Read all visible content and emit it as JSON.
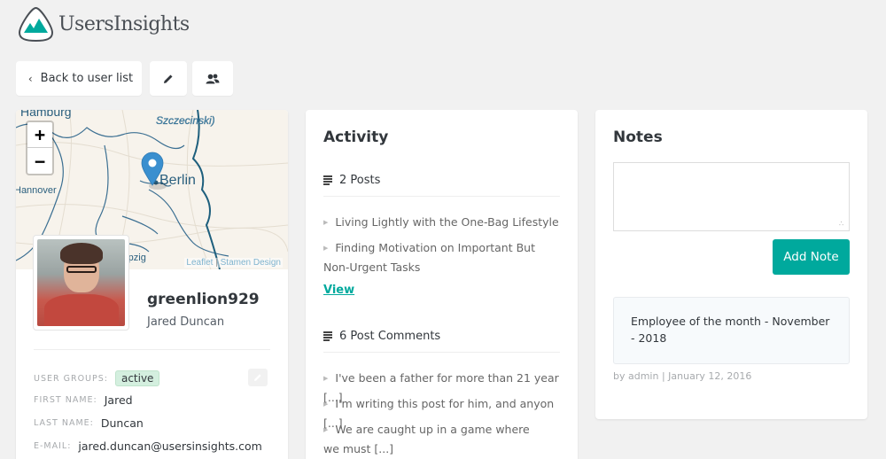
{
  "app": {
    "name": "UsersInsights",
    "brand_color": "#00a99d"
  },
  "toolbar": {
    "back_label": "Back to user list",
    "back_icon": "chevron-left-icon",
    "edit_icon": "pencil-icon",
    "groups_icon": "users-icon"
  },
  "profile": {
    "map": {
      "zoom_in": "+",
      "zoom_out": "−",
      "labels": [
        "Hamburg",
        "Szczecinski)",
        "Berlin",
        "Hannover",
        "Leipzig"
      ],
      "marker_location": "Berlin",
      "attribution_leaflet": "Leaflet",
      "attribution_sep": "|",
      "attribution_tiles": "Stamen Design"
    },
    "username": "greenlion929",
    "full_name": "Jared Duncan",
    "fields": {
      "user_groups_label": "USER GROUPS:",
      "user_groups_value": "active",
      "first_name_label": "FIRST NAME:",
      "first_name_value": "Jared",
      "last_name_label": "LAST NAME:",
      "last_name_value": "Duncan",
      "email_label": "E-MAIL:",
      "email_value": "jared.duncan@usersinsights.com"
    }
  },
  "activity": {
    "title": "Activity",
    "posts": {
      "heading": "2 Posts",
      "items": [
        "Living Lightly with the One-Bag Lifestyle",
        "Finding Motivation on Important But Non-Urgent Tasks"
      ],
      "view_label": "View"
    },
    "comments": {
      "heading": "6 Post Comments",
      "items": [
        "I've been a father for more than 21 year [...]",
        "I'm writing this post for him, and anyon [...]",
        "We are caught up in a game where we must [...]"
      ]
    }
  },
  "notes": {
    "title": "Notes",
    "input_value": "",
    "add_label": "Add Note",
    "items": [
      {
        "text": "Employee of the month - November - 2018",
        "meta": "by admin | January 12, 2016"
      }
    ]
  }
}
